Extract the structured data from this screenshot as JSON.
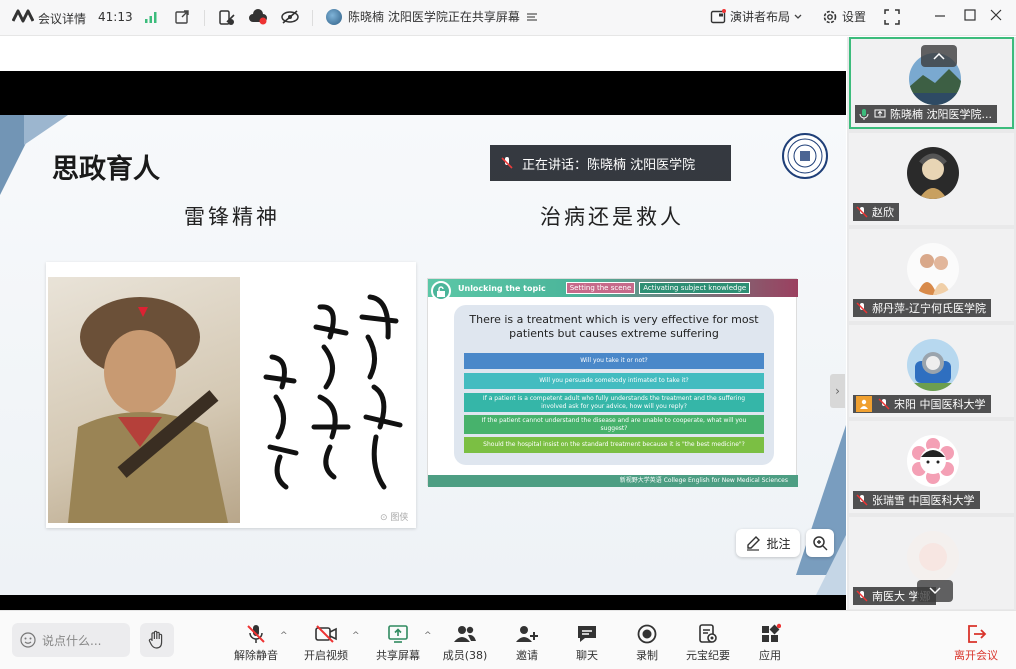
{
  "topbar": {
    "meeting_details": "会议详情",
    "duration": "41:13",
    "share_status": "陈晓楠 沈阳医学院正在共享屏幕",
    "layout_label": "演讲者布局",
    "settings_label": "设置"
  },
  "slide": {
    "title": "思政育人",
    "subtitle_left": "雷锋精神",
    "subtitle_right": "治病还是救人",
    "speaking_now": "正在讲话：陈晓楠 沈阳医学院",
    "watermark": "⊙ 图侠",
    "topic_card": {
      "tab_unlocking": "Unlocking the topic",
      "tab_setting": "Setting the scene",
      "tab_activating": "Activating subject knowledge",
      "question": "There is a treatment which is very effective for most patients but causes extreme suffering",
      "options": [
        {
          "text": "Will you take it or not?",
          "color": "#4a88c9"
        },
        {
          "text": "Will you persuade somebody intimated to take it?",
          "color": "#43bcc0"
        },
        {
          "text": "If a patient is a competent adult who fully understands the treatment and the suffering involved ask for your advice, how will you reply?",
          "color": "#35b6a8"
        },
        {
          "text": "If the patient cannot understand the disease and are unable to cooperate, what will you suggest?",
          "color": "#47b26c"
        },
        {
          "text": "Should the hospital insist on the standard treatment because it is \"the best medicine\"?",
          "color": "#7bbf43"
        }
      ],
      "footer": "新视野大学英语  College English for New Medical Sciences"
    },
    "annotate_label": "批注"
  },
  "participants": [
    {
      "name": "陈晓楠 沈阳医学院...",
      "active": true
    },
    {
      "name": "赵欣",
      "active": false
    },
    {
      "name": "郝丹萍-辽宁何氏医学院",
      "active": false
    },
    {
      "name": "宋阳 中国医科大学",
      "active": false,
      "host": true
    },
    {
      "name": "张瑞雪 中国医科大学",
      "active": false
    },
    {
      "name": "南医大 学娜",
      "active": false
    }
  ],
  "toolbar": {
    "chat_placeholder": "说点什么...",
    "unmute": "解除静音",
    "start_video": "开启视频",
    "share_screen": "共享屏幕",
    "members": "成员(38)",
    "invite": "邀请",
    "chat": "聊天",
    "record": "录制",
    "minutes": "元宝纪要",
    "apps": "应用",
    "leave": "离开会议"
  }
}
